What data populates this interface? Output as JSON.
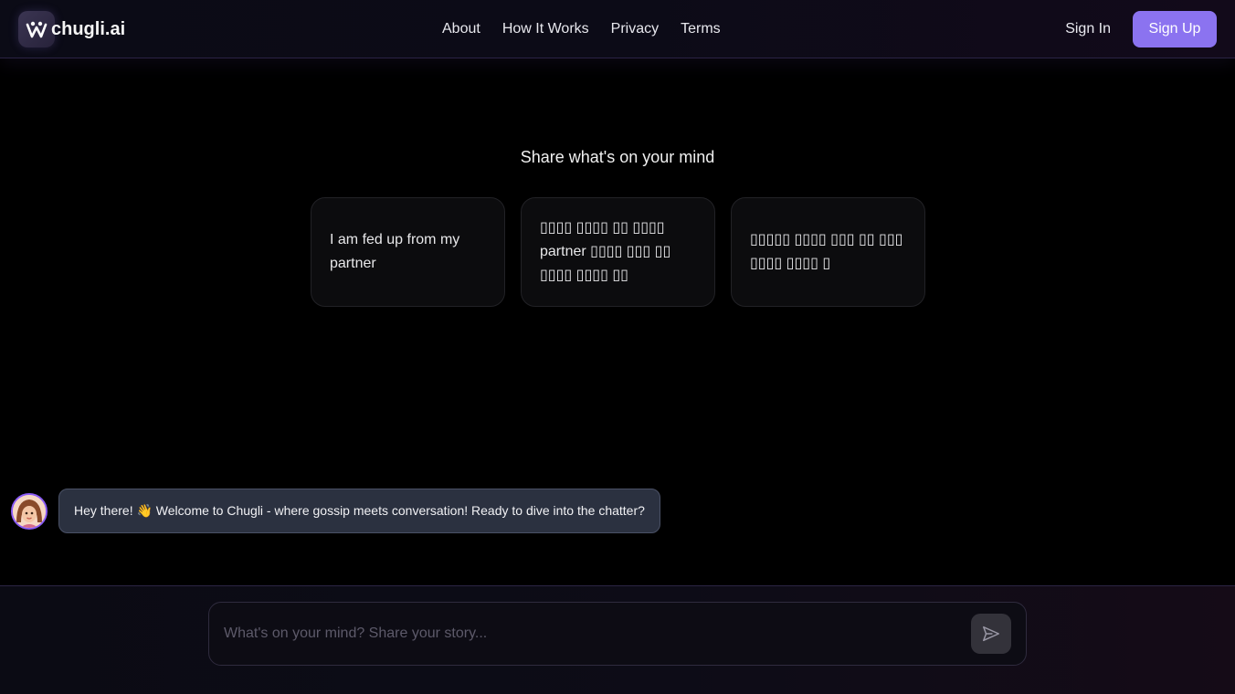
{
  "header": {
    "brand": "chugli.ai",
    "nav": [
      "About",
      "How It Works",
      "Privacy",
      "Terms"
    ],
    "sign_in": "Sign In",
    "sign_up": "Sign Up"
  },
  "prompts": {
    "title": "Share what's on your mind",
    "cards": [
      "I am fed up from my partner",
      "▯▯▯▯ ▯▯▯▯ ▯▯ ▯▯▯▯ partner ▯▯▯▯ ▯▯▯ ▯▯ ▯▯▯▯ ▯▯▯▯ ▯▯",
      "▯▯▯▯▯ ▯▯▯▯ ▯▯▯ ▯▯ ▯▯▯ ▯▯▯▯ ▯▯▯▯ ▯"
    ]
  },
  "chat": {
    "greeting": "Hey there! 👋 Welcome to Chugli - where gossip meets conversation! Ready to dive into the chatter?"
  },
  "composer": {
    "placeholder": "What's on your mind? Share your story..."
  },
  "colors": {
    "accent": "#8b73f0",
    "bubble": "#2b3140"
  },
  "icons": {
    "logo": "logo-icon",
    "avatar": "assistant-avatar",
    "send": "send-icon"
  }
}
